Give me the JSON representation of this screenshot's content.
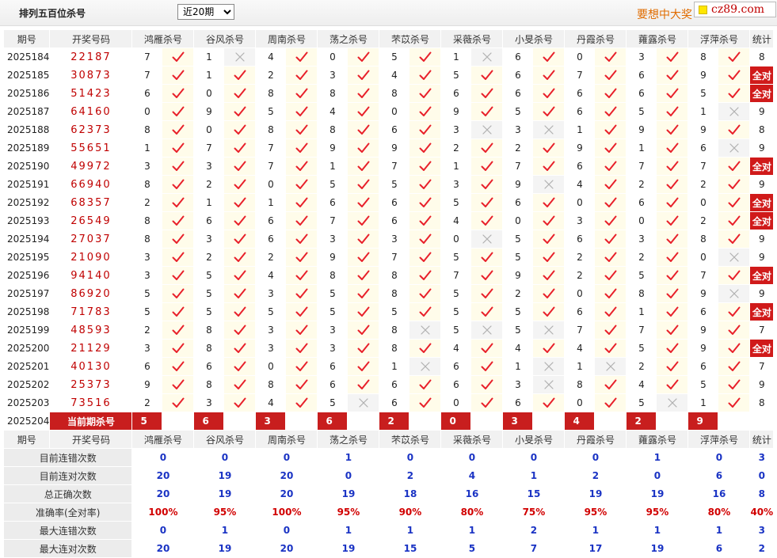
{
  "header": {
    "title": "排列五百位杀号",
    "select_value": "近20期",
    "select_options": [
      "近20期"
    ],
    "slogan": "要想中大奖",
    "site_badge": "cz89.com"
  },
  "table": {
    "columns": [
      "期号",
      "开奖号码",
      "鸿雁杀号",
      "谷风杀号",
      "周南杀号",
      "荡之杀号",
      "芣苡杀号",
      "采薇杀号",
      "小旻杀号",
      "丹霞杀号",
      "蕹露杀号",
      "浮萍杀号",
      "统计"
    ],
    "rows": [
      {
        "period": "2025184",
        "numbers": "22187",
        "kills": [
          [
            7,
            true
          ],
          [
            1,
            false
          ],
          [
            4,
            true
          ],
          [
            0,
            true
          ],
          [
            5,
            true
          ],
          [
            1,
            false
          ],
          [
            6,
            true
          ],
          [
            0,
            true
          ],
          [
            3,
            true
          ],
          [
            8,
            true
          ]
        ],
        "stat": "8"
      },
      {
        "period": "2025185",
        "numbers": "30873",
        "kills": [
          [
            7,
            true
          ],
          [
            1,
            true
          ],
          [
            2,
            true
          ],
          [
            3,
            true
          ],
          [
            4,
            true
          ],
          [
            5,
            true
          ],
          [
            6,
            true
          ],
          [
            7,
            true
          ],
          [
            6,
            true
          ],
          [
            9,
            true
          ]
        ],
        "stat": "全对"
      },
      {
        "period": "2025186",
        "numbers": "51423",
        "kills": [
          [
            6,
            true
          ],
          [
            0,
            true
          ],
          [
            8,
            true
          ],
          [
            8,
            true
          ],
          [
            8,
            true
          ],
          [
            6,
            true
          ],
          [
            6,
            true
          ],
          [
            6,
            true
          ],
          [
            6,
            true
          ],
          [
            5,
            true
          ]
        ],
        "stat": "全对"
      },
      {
        "period": "2025187",
        "numbers": "64160",
        "kills": [
          [
            0,
            true
          ],
          [
            9,
            true
          ],
          [
            5,
            true
          ],
          [
            4,
            true
          ],
          [
            0,
            true
          ],
          [
            9,
            true
          ],
          [
            5,
            true
          ],
          [
            6,
            true
          ],
          [
            5,
            true
          ],
          [
            1,
            false
          ]
        ],
        "stat": "9"
      },
      {
        "period": "2025188",
        "numbers": "62373",
        "kills": [
          [
            8,
            true
          ],
          [
            0,
            true
          ],
          [
            8,
            true
          ],
          [
            8,
            true
          ],
          [
            6,
            true
          ],
          [
            3,
            false
          ],
          [
            3,
            false
          ],
          [
            1,
            true
          ],
          [
            9,
            true
          ],
          [
            9,
            true
          ]
        ],
        "stat": "8"
      },
      {
        "period": "2025189",
        "numbers": "55651",
        "kills": [
          [
            1,
            true
          ],
          [
            7,
            true
          ],
          [
            7,
            true
          ],
          [
            9,
            true
          ],
          [
            9,
            true
          ],
          [
            2,
            true
          ],
          [
            2,
            true
          ],
          [
            9,
            true
          ],
          [
            1,
            true
          ],
          [
            6,
            false
          ]
        ],
        "stat": "9"
      },
      {
        "period": "2025190",
        "numbers": "49972",
        "kills": [
          [
            3,
            true
          ],
          [
            3,
            true
          ],
          [
            7,
            true
          ],
          [
            1,
            true
          ],
          [
            7,
            true
          ],
          [
            1,
            true
          ],
          [
            7,
            true
          ],
          [
            6,
            true
          ],
          [
            7,
            true
          ],
          [
            7,
            true
          ]
        ],
        "stat": "全对"
      },
      {
        "period": "2025191",
        "numbers": "66940",
        "kills": [
          [
            8,
            true
          ],
          [
            2,
            true
          ],
          [
            0,
            true
          ],
          [
            5,
            true
          ],
          [
            5,
            true
          ],
          [
            3,
            true
          ],
          [
            9,
            false
          ],
          [
            4,
            true
          ],
          [
            2,
            true
          ],
          [
            2,
            true
          ]
        ],
        "stat": "9"
      },
      {
        "period": "2025192",
        "numbers": "68357",
        "kills": [
          [
            2,
            true
          ],
          [
            1,
            true
          ],
          [
            1,
            true
          ],
          [
            6,
            true
          ],
          [
            6,
            true
          ],
          [
            5,
            true
          ],
          [
            6,
            true
          ],
          [
            0,
            true
          ],
          [
            6,
            true
          ],
          [
            0,
            true
          ]
        ],
        "stat": "全对"
      },
      {
        "period": "2025193",
        "numbers": "26549",
        "kills": [
          [
            8,
            true
          ],
          [
            6,
            true
          ],
          [
            6,
            true
          ],
          [
            7,
            true
          ],
          [
            6,
            true
          ],
          [
            4,
            true
          ],
          [
            0,
            true
          ],
          [
            3,
            true
          ],
          [
            0,
            true
          ],
          [
            2,
            true
          ]
        ],
        "stat": "全对"
      },
      {
        "period": "2025194",
        "numbers": "27037",
        "kills": [
          [
            8,
            true
          ],
          [
            3,
            true
          ],
          [
            6,
            true
          ],
          [
            3,
            true
          ],
          [
            3,
            true
          ],
          [
            0,
            false
          ],
          [
            5,
            true
          ],
          [
            6,
            true
          ],
          [
            3,
            true
          ],
          [
            8,
            true
          ]
        ],
        "stat": "9"
      },
      {
        "period": "2025195",
        "numbers": "21090",
        "kills": [
          [
            3,
            true
          ],
          [
            2,
            true
          ],
          [
            2,
            true
          ],
          [
            9,
            true
          ],
          [
            7,
            true
          ],
          [
            5,
            true
          ],
          [
            5,
            true
          ],
          [
            2,
            true
          ],
          [
            2,
            true
          ],
          [
            0,
            false
          ]
        ],
        "stat": "9"
      },
      {
        "period": "2025196",
        "numbers": "94140",
        "kills": [
          [
            3,
            true
          ],
          [
            5,
            true
          ],
          [
            4,
            true
          ],
          [
            8,
            true
          ],
          [
            8,
            true
          ],
          [
            7,
            true
          ],
          [
            9,
            true
          ],
          [
            2,
            true
          ],
          [
            5,
            true
          ],
          [
            7,
            true
          ]
        ],
        "stat": "全对"
      },
      {
        "period": "2025197",
        "numbers": "86920",
        "kills": [
          [
            5,
            true
          ],
          [
            5,
            true
          ],
          [
            3,
            true
          ],
          [
            5,
            true
          ],
          [
            8,
            true
          ],
          [
            5,
            true
          ],
          [
            2,
            true
          ],
          [
            0,
            true
          ],
          [
            8,
            true
          ],
          [
            9,
            false
          ]
        ],
        "stat": "9"
      },
      {
        "period": "2025198",
        "numbers": "71783",
        "kills": [
          [
            5,
            true
          ],
          [
            5,
            true
          ],
          [
            5,
            true
          ],
          [
            5,
            true
          ],
          [
            5,
            true
          ],
          [
            5,
            true
          ],
          [
            5,
            true
          ],
          [
            6,
            true
          ],
          [
            1,
            true
          ],
          [
            6,
            true
          ]
        ],
        "stat": "全对"
      },
      {
        "period": "2025199",
        "numbers": "48593",
        "kills": [
          [
            2,
            true
          ],
          [
            8,
            true
          ],
          [
            3,
            true
          ],
          [
            3,
            true
          ],
          [
            8,
            false
          ],
          [
            5,
            false
          ],
          [
            5,
            false
          ],
          [
            7,
            true
          ],
          [
            7,
            true
          ],
          [
            9,
            true
          ]
        ],
        "stat": "7"
      },
      {
        "period": "2025200",
        "numbers": "21129",
        "kills": [
          [
            3,
            true
          ],
          [
            8,
            true
          ],
          [
            3,
            true
          ],
          [
            3,
            true
          ],
          [
            8,
            true
          ],
          [
            4,
            true
          ],
          [
            4,
            true
          ],
          [
            4,
            true
          ],
          [
            5,
            true
          ],
          [
            9,
            true
          ]
        ],
        "stat": "全对"
      },
      {
        "period": "2025201",
        "numbers": "40130",
        "kills": [
          [
            6,
            true
          ],
          [
            6,
            true
          ],
          [
            0,
            true
          ],
          [
            6,
            true
          ],
          [
            1,
            false
          ],
          [
            6,
            true
          ],
          [
            1,
            false
          ],
          [
            1,
            false
          ],
          [
            2,
            true
          ],
          [
            6,
            true
          ]
        ],
        "stat": "7"
      },
      {
        "period": "2025202",
        "numbers": "25373",
        "kills": [
          [
            9,
            true
          ],
          [
            8,
            true
          ],
          [
            8,
            true
          ],
          [
            6,
            true
          ],
          [
            6,
            true
          ],
          [
            6,
            true
          ],
          [
            3,
            false
          ],
          [
            8,
            true
          ],
          [
            4,
            true
          ],
          [
            5,
            true
          ]
        ],
        "stat": "9"
      },
      {
        "period": "2025203",
        "numbers": "73516",
        "kills": [
          [
            2,
            true
          ],
          [
            3,
            true
          ],
          [
            4,
            true
          ],
          [
            5,
            false
          ],
          [
            6,
            true
          ],
          [
            0,
            true
          ],
          [
            6,
            true
          ],
          [
            0,
            true
          ],
          [
            5,
            false
          ],
          [
            1,
            true
          ]
        ],
        "stat": "8"
      }
    ],
    "current": {
      "period": "2025204",
      "label": "当前期杀号",
      "values": [
        "5",
        "6",
        "3",
        "6",
        "2",
        "0",
        "3",
        "4",
        "2",
        "9"
      ]
    },
    "summary": [
      {
        "label": "目前连错次数",
        "values": [
          "0",
          "0",
          "0",
          "1",
          "0",
          "0",
          "0",
          "0",
          "1",
          "0",
          "3"
        ],
        "pct": false
      },
      {
        "label": "目前连对次数",
        "values": [
          "20",
          "19",
          "20",
          "0",
          "2",
          "4",
          "1",
          "2",
          "0",
          "6",
          "0"
        ],
        "pct": false
      },
      {
        "label": "总正确次数",
        "values": [
          "20",
          "19",
          "20",
          "19",
          "18",
          "16",
          "15",
          "19",
          "19",
          "16",
          "8"
        ],
        "pct": false
      },
      {
        "label": "准确率(全对率)",
        "values": [
          "100%",
          "95%",
          "100%",
          "95%",
          "90%",
          "80%",
          "75%",
          "95%",
          "95%",
          "80%",
          "40%"
        ],
        "pct": true
      },
      {
        "label": "最大连错次数",
        "values": [
          "0",
          "1",
          "0",
          "1",
          "1",
          "1",
          "2",
          "1",
          "1",
          "1",
          "3"
        ],
        "pct": false
      },
      {
        "label": "最大连对次数",
        "values": [
          "20",
          "19",
          "20",
          "19",
          "15",
          "5",
          "7",
          "17",
          "19",
          "6",
          "2"
        ],
        "pct": false
      }
    ]
  },
  "colors": {
    "check": "#e8202a",
    "cross": "#b0b0b0",
    "accent_red": "#c81e1e",
    "summary_blue": "#1a33c4",
    "summary_pct": "#d10000"
  },
  "icons": {
    "correct": "check-icon",
    "wrong": "cross-icon",
    "badge": "yellow-square-icon"
  }
}
